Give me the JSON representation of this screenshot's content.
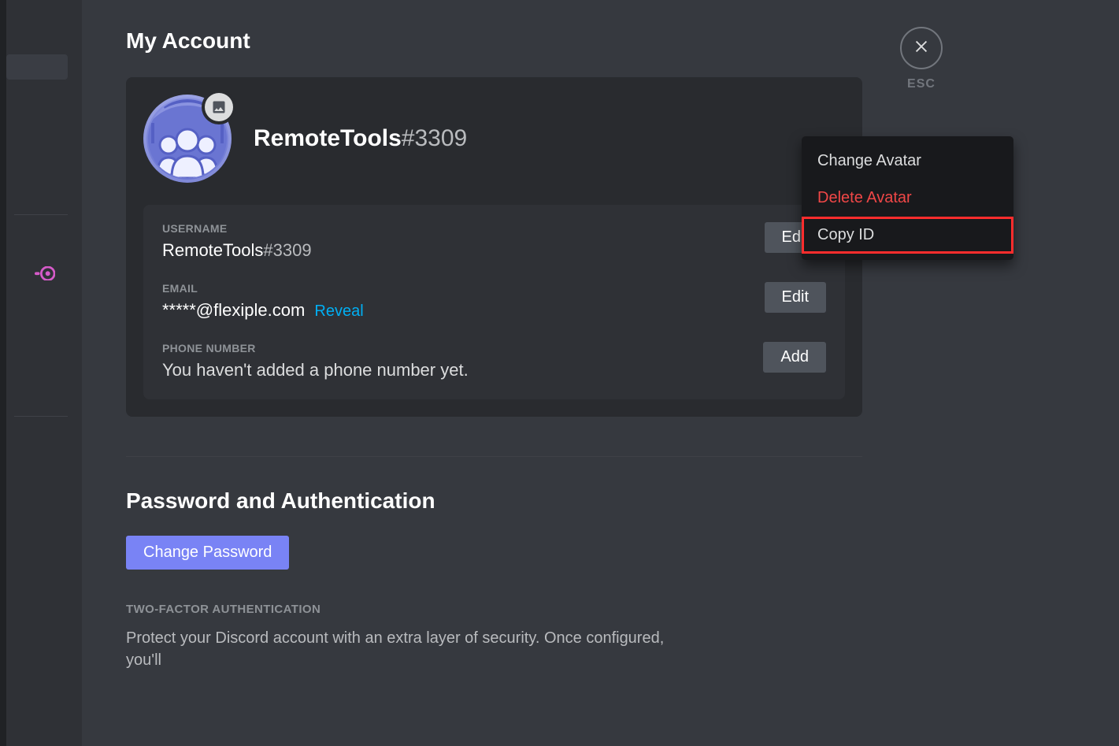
{
  "page": {
    "title": "My Account",
    "esc_label": "ESC"
  },
  "profile": {
    "name": "RemoteTools",
    "discriminator": "#3309"
  },
  "fields": {
    "username_label": "USERNAME",
    "username_name": "RemoteTools",
    "username_discriminator": "#3309",
    "username_edit": "Edit",
    "email_label": "EMAIL",
    "email_value": "*****@flexiple.com",
    "email_reveal": "Reveal",
    "email_edit": "Edit",
    "phone_label": "PHONE NUMBER",
    "phone_value": "You haven't added a phone number yet.",
    "phone_add": "Add"
  },
  "password_section": {
    "title": "Password and Authentication",
    "change_btn": "Change Password",
    "twofa_label": "TWO-FACTOR AUTHENTICATION",
    "twofa_desc": "Protect your Discord account with an extra layer of security. Once configured, you'll"
  },
  "context_menu": {
    "change_avatar": "Change Avatar",
    "delete_avatar": "Delete Avatar",
    "copy_id": "Copy ID"
  }
}
